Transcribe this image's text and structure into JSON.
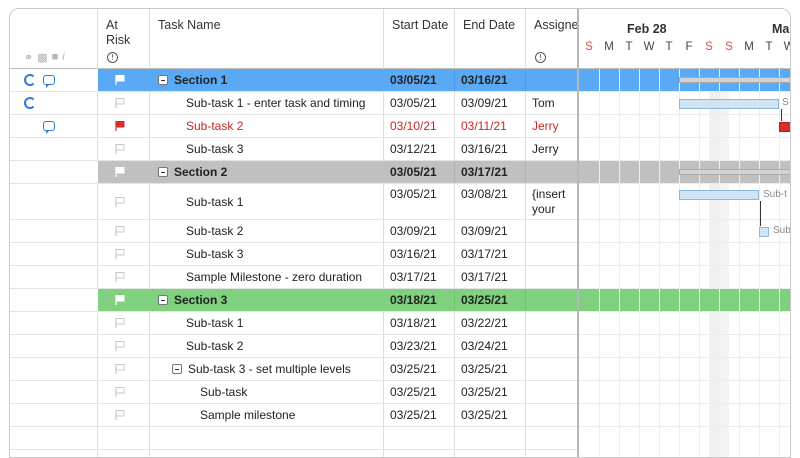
{
  "columns": {
    "at_risk": "At Risk",
    "task_name": "Task Name",
    "start_date": "Start Date",
    "end_date": "End Date",
    "assigned": "Assigne"
  },
  "gantt": {
    "month_1": "Feb 28",
    "month_2": "Ma",
    "day_letters": [
      "S",
      "M",
      "T",
      "W",
      "T",
      "F",
      "S",
      "S",
      "M",
      "T",
      "W"
    ],
    "bar_labels": [
      "S",
      "Sub-t",
      "Sub"
    ]
  },
  "colors": {
    "section_1": "#5aa9f5",
    "section_2": "#c0c0c0",
    "section_3": "#7fd17f",
    "at_risk_flag": "#d32f2f",
    "icon_blue": "#2f7bd7"
  },
  "rows": [
    {
      "icons": [
        "at-icon",
        "comment-icon"
      ],
      "flag": "white",
      "name": "Section 1",
      "start": "03/05/21",
      "end": "03/16/21",
      "assigned": "",
      "level": 0,
      "section": 1
    },
    {
      "icons": [
        "at-icon"
      ],
      "flag": "outline",
      "name": "Sub-task 1 - enter task and timing",
      "start": "03/05/21",
      "end": "03/09/21",
      "assigned": "Tom",
      "level": 1
    },
    {
      "icons": [
        "comment-icon"
      ],
      "flag": "red",
      "name": "Sub-task 2",
      "start": "03/10/21",
      "end": "03/11/21",
      "assigned": "Jerry",
      "level": 1,
      "red": true
    },
    {
      "icons": [],
      "flag": "outline",
      "name": "Sub-task 3",
      "start": "03/12/21",
      "end": "03/16/21",
      "assigned": "Jerry",
      "level": 1
    },
    {
      "icons": [],
      "flag": "white",
      "name": "Section 2",
      "start": "03/05/21",
      "end": "03/17/21",
      "assigned": "",
      "level": 0,
      "section": 2
    },
    {
      "icons": [],
      "flag": "outline",
      "name": "Sub-task 1",
      "start": "03/05/21",
      "end": "03/08/21",
      "assigned": "{insert your name}",
      "level": 1,
      "tall": true
    },
    {
      "icons": [],
      "flag": "outline",
      "name": "Sub-task 2",
      "start": "03/09/21",
      "end": "03/09/21",
      "assigned": "",
      "level": 1
    },
    {
      "icons": [],
      "flag": "outline",
      "name": "Sub-task 3",
      "start": "03/16/21",
      "end": "03/17/21",
      "assigned": "",
      "level": 1
    },
    {
      "icons": [],
      "flag": "outline",
      "name": "Sample Milestone - zero duration",
      "start": "03/17/21",
      "end": "03/17/21",
      "assigned": "",
      "level": 1
    },
    {
      "icons": [],
      "flag": "white",
      "name": "Section 3",
      "start": "03/18/21",
      "end": "03/25/21",
      "assigned": "",
      "level": 0,
      "section": 3
    },
    {
      "icons": [],
      "flag": "outline",
      "name": "Sub-task 1",
      "start": "03/18/21",
      "end": "03/22/21",
      "assigned": "",
      "level": 1
    },
    {
      "icons": [],
      "flag": "outline",
      "name": "Sub-task 2",
      "start": "03/23/21",
      "end": "03/24/21",
      "assigned": "",
      "level": 1
    },
    {
      "icons": [],
      "flag": "outline",
      "name": "Sub-task 3 - set multiple levels",
      "start": "03/25/21",
      "end": "03/25/21",
      "assigned": "",
      "level": 1,
      "collapsible": true
    },
    {
      "icons": [],
      "flag": "outline",
      "name": "Sub-task",
      "start": "03/25/21",
      "end": "03/25/21",
      "assigned": "",
      "level": 2
    },
    {
      "icons": [],
      "flag": "outline",
      "name": "Sample milestone",
      "start": "03/25/21",
      "end": "03/25/21",
      "assigned": "",
      "level": 2
    }
  ]
}
